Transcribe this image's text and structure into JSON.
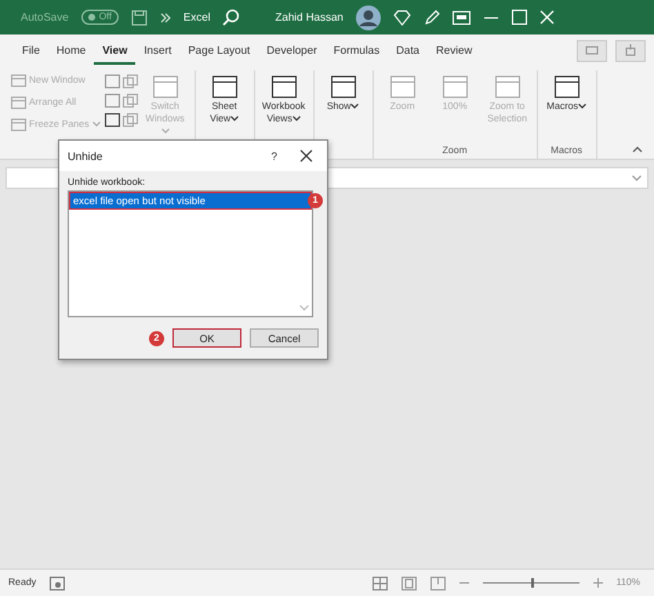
{
  "title_bar": {
    "autosave": "AutoSave",
    "toggle": {
      "text": "Off",
      "on": false
    },
    "app": "Excel",
    "user": "Zahid Hassan"
  },
  "tabs": [
    {
      "label": "File",
      "selected": false
    },
    {
      "label": "Home",
      "selected": false
    },
    {
      "label": "View",
      "selected": true
    },
    {
      "label": "Insert",
      "selected": false
    },
    {
      "label": "Page Layout",
      "selected": false
    },
    {
      "label": "Developer",
      "selected": false
    },
    {
      "label": "Formulas",
      "selected": false
    },
    {
      "label": "Data",
      "selected": false
    },
    {
      "label": "Review",
      "selected": false
    }
  ],
  "ribbon": {
    "groups": [
      {
        "buttons": [
          {
            "kind": "small",
            "label": "New Window",
            "disabled": true,
            "dropdown": false
          },
          {
            "kind": "small",
            "label": "Arrange All",
            "disabled": true,
            "dropdown": false
          },
          {
            "kind": "small",
            "label": "Freeze Panes",
            "disabled": true,
            "dropdown": true
          },
          {
            "kind": "large",
            "label": "Switch Windows",
            "disabled": true,
            "dropdown": true
          }
        ]
      },
      {
        "buttons": [
          {
            "kind": "large",
            "label": "Sheet View",
            "disabled": false,
            "dropdown": true
          }
        ]
      },
      {
        "buttons": [
          {
            "kind": "large",
            "label": "Workbook Views",
            "disabled": false,
            "dropdown": true
          }
        ]
      },
      {
        "buttons": [
          {
            "kind": "large",
            "label": "Show",
            "disabled": false,
            "dropdown": true
          }
        ]
      },
      {
        "label": "Zoom",
        "buttons": [
          {
            "kind": "large",
            "label": "Zoom",
            "disabled": true,
            "dropdown": false
          },
          {
            "kind": "large",
            "label": "100%",
            "disabled": true,
            "dropdown": false
          },
          {
            "kind": "large",
            "label": "Zoom to Selection",
            "disabled": true,
            "dropdown": false
          }
        ]
      },
      {
        "label": "Macros",
        "buttons": [
          {
            "kind": "large",
            "label": "Macros",
            "disabled": false,
            "dropdown": true
          }
        ]
      }
    ]
  },
  "dialog": {
    "title": "Unhide",
    "help": "?",
    "list_label": "Unhide workbook:",
    "items": [
      {
        "text": "excel file open but not visible",
        "selected": true
      }
    ],
    "buttons": [
      {
        "label": "OK",
        "default": true
      },
      {
        "label": "Cancel",
        "default": false
      }
    ],
    "callouts": [
      "1",
      "2"
    ]
  },
  "status_bar": {
    "status": "Ready",
    "zoom": "110%",
    "level": 0.5
  }
}
